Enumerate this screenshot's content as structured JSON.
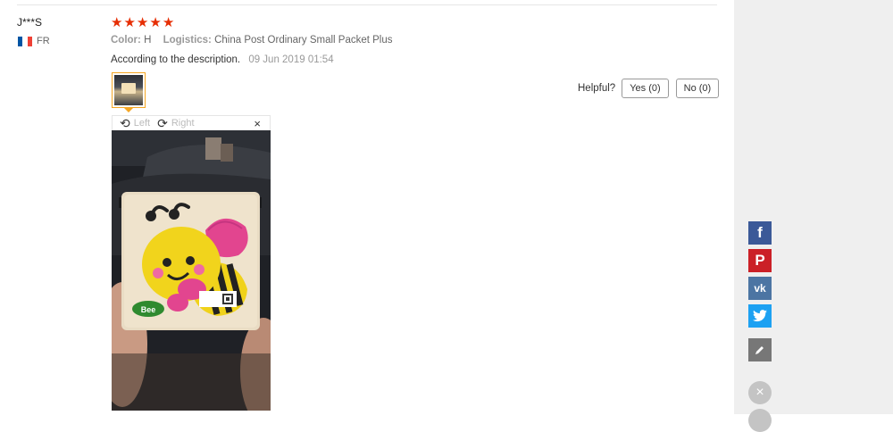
{
  "review": {
    "user_name": "J***S",
    "country_code": "FR",
    "flag_colors": [
      "#0055a4",
      "#ffffff",
      "#ef4135"
    ],
    "rating": 5,
    "star_glyph": "★",
    "color_label": "Color:",
    "color_value": "H",
    "logistics_label": "Logistics:",
    "logistics_value": "China Post Ordinary Small Packet Plus",
    "text": "According to the description.",
    "date": "09 Jun 2019 01:54"
  },
  "viewer": {
    "rotate_left_label": "Left",
    "rotate_right_label": "Right",
    "close_glyph": "×"
  },
  "photo": {
    "puzzle_label": "Bee"
  },
  "helpful": {
    "label": "Helpful?",
    "yes_label": "Yes (0)",
    "no_label": "No (0)"
  },
  "social": {
    "facebook_glyph": "f",
    "pinterest_glyph": "P",
    "vk_glyph": "vk",
    "colors": {
      "facebook": "#3b5998",
      "pinterest": "#cb2027",
      "vk": "#4c75a3",
      "twitter": "#1da1f2"
    }
  },
  "accent_colors": {
    "star": "#e62e04",
    "thumb_border": "#f5a623"
  }
}
